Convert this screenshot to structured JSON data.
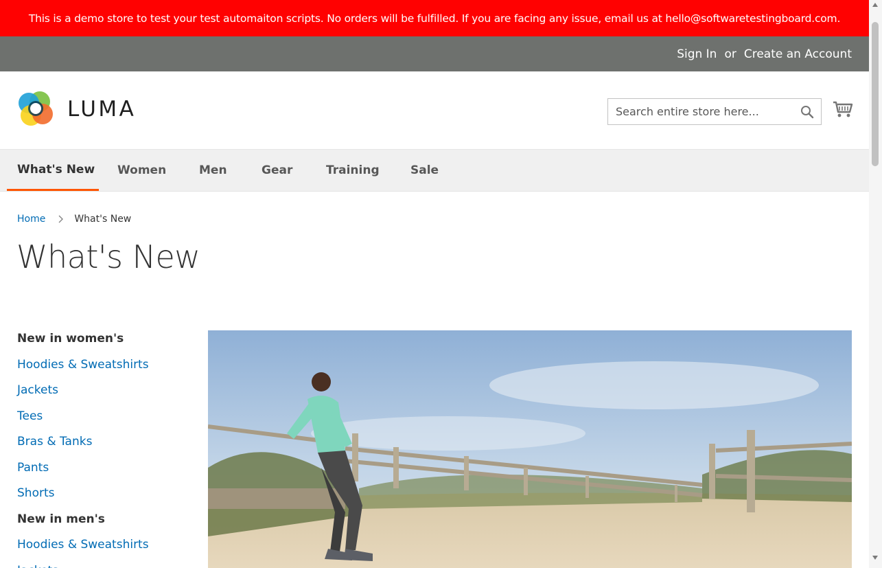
{
  "demo_banner": {
    "text": "This is a demo store to test your test automaiton scripts. No orders will be fulfilled. If you are facing any issue, email us at hello@softwaretestingboard.com."
  },
  "panel_header": {
    "sign_in": "Sign In",
    "or": "or",
    "create_account": "Create an Account"
  },
  "header": {
    "logo_text": "LUMA",
    "search_placeholder": "Search entire store here...",
    "search_icon": "search-icon",
    "cart_icon": "cart-icon"
  },
  "nav": {
    "items": [
      {
        "label": "What's New",
        "active": true
      },
      {
        "label": "Women",
        "active": false
      },
      {
        "label": "Men",
        "active": false
      },
      {
        "label": "Gear",
        "active": false
      },
      {
        "label": "Training",
        "active": false
      },
      {
        "label": "Sale",
        "active": false
      }
    ]
  },
  "breadcrumb": {
    "home": "Home",
    "current": "What's New"
  },
  "page": {
    "title": "What's New"
  },
  "sidebar": {
    "womens_heading": "New in women's",
    "womens_links": [
      "Hoodies & Sweatshirts",
      "Jackets",
      "Tees",
      "Bras & Tanks",
      "Pants",
      "Shorts"
    ],
    "mens_heading": "New in men's",
    "mens_links": [
      "Hoodies & Sweatshirts",
      "Jackets"
    ]
  },
  "colors": {
    "banner_red": "#ff0101",
    "panel_gray": "#6e716e",
    "link_blue": "#006bb4",
    "active_orange": "#ff5501"
  }
}
